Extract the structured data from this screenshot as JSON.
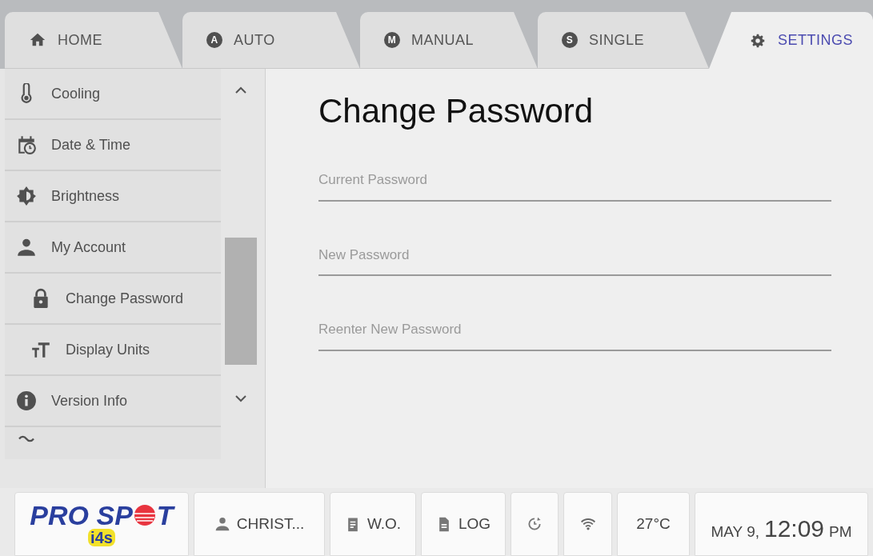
{
  "tabs": [
    {
      "label": "HOME",
      "selected": false
    },
    {
      "label": "AUTO",
      "badge": "A",
      "selected": false
    },
    {
      "label": "MANUAL",
      "badge": "M",
      "selected": false
    },
    {
      "label": "SINGLE",
      "badge": "S",
      "selected": false
    },
    {
      "label": "SETTINGS",
      "selected": true
    }
  ],
  "sidebar": {
    "items": [
      {
        "label": "Cooling"
      },
      {
        "label": "Date & Time"
      },
      {
        "label": "Brightness"
      },
      {
        "label": "My Account",
        "children": [
          {
            "label": "Change Password"
          },
          {
            "label": "Display Units"
          }
        ]
      },
      {
        "label": "Version Info"
      }
    ]
  },
  "form": {
    "title": "Change Password",
    "fields": [
      {
        "placeholder": "Current Password"
      },
      {
        "placeholder": "New Password"
      },
      {
        "placeholder": "Reenter New Password"
      }
    ]
  },
  "footer": {
    "logo": {
      "text_before": "PRO SP",
      "text_after": "T",
      "badge": "i4s"
    },
    "user": "CHRIST...",
    "work_order": "W.O.",
    "log": "LOG",
    "temperature": "27°C",
    "date": "MAY 9,",
    "time": "12:09",
    "meridiem": "PM"
  }
}
